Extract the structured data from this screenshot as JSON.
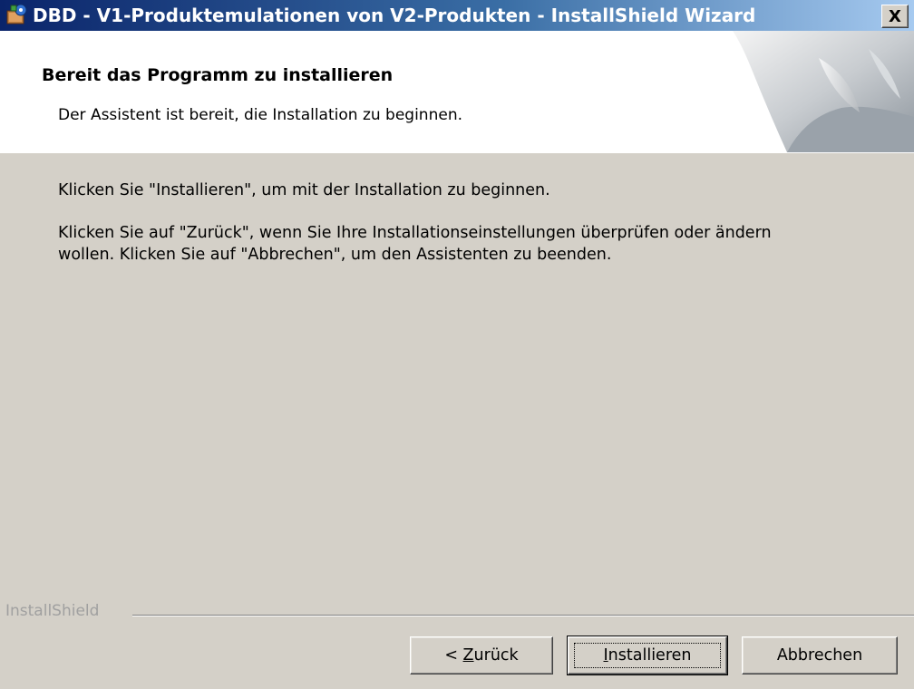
{
  "window": {
    "title": "DBD - V1-Produktemulationen von V2-Produkten - InstallShield Wizard",
    "close_label": "X"
  },
  "header": {
    "title": "Bereit das Programm zu installieren",
    "subtitle": "Der Assistent ist bereit, die Installation zu beginnen."
  },
  "body": {
    "paragraph1": "Klicken Sie \"Installieren\", um mit der Installation zu beginnen.",
    "paragraph2_line1": "Klicken Sie auf \"Zurück\", wenn Sie Ihre Installationseinstellungen überprüfen oder ändern",
    "paragraph2_line2": "wollen. Klicken Sie auf \"Abbrechen\", um den Assistenten zu beenden."
  },
  "footer": {
    "brand": "InstallShield",
    "back_prefix": "< ",
    "back_mnemonic": "Z",
    "back_rest": "urück",
    "install_mnemonic": "I",
    "install_rest": "nstallieren",
    "cancel_label": "Abbrechen"
  },
  "colors": {
    "titlebar_start": "#0a246a",
    "titlebar_end": "#a6caf0",
    "dialog_bg": "#d4d0c8",
    "header_bg": "#ffffff"
  },
  "icons": {
    "app": "installer-icon",
    "close": "close-icon",
    "header_graphic": "paper-curl-graphic"
  }
}
